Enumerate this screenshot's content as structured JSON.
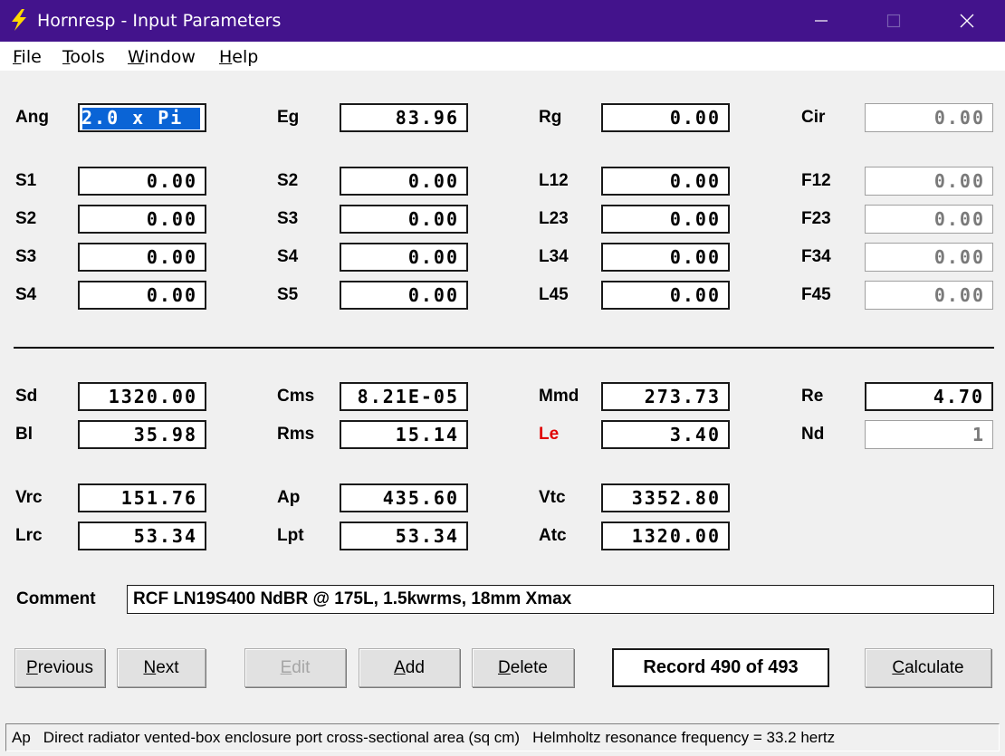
{
  "window": {
    "title": "Hornresp - Input Parameters",
    "title_bar_color": "#43138c",
    "controls": [
      "minimize-icon",
      "maximize-icon",
      "close-icon"
    ]
  },
  "menu": [
    {
      "first": "F",
      "rest": "ile"
    },
    {
      "first": "T",
      "rest": "ools"
    },
    {
      "first": "W",
      "rest": "indow"
    },
    {
      "first": "H",
      "rest": "elp"
    }
  ],
  "rows": {
    "top": {
      "ang": {
        "label": "Ang",
        "value": "2.0 x Pi"
      },
      "eg": {
        "label": "Eg",
        "value": "83.96"
      },
      "rg": {
        "label": "Rg",
        "value": "0.00"
      },
      "cir": {
        "label": "Cir",
        "value": "0.00"
      }
    },
    "horn": [
      [
        {
          "label": "S1",
          "value": "0.00"
        },
        {
          "label": "S2",
          "value": "0.00"
        },
        {
          "label": "L12",
          "value": "0.00"
        },
        {
          "label": "F12",
          "value": "0.00"
        }
      ],
      [
        {
          "label": "S2",
          "value": "0.00"
        },
        {
          "label": "S3",
          "value": "0.00"
        },
        {
          "label": "L23",
          "value": "0.00"
        },
        {
          "label": "F23",
          "value": "0.00"
        }
      ],
      [
        {
          "label": "S3",
          "value": "0.00"
        },
        {
          "label": "S4",
          "value": "0.00"
        },
        {
          "label": "L34",
          "value": "0.00"
        },
        {
          "label": "F34",
          "value": "0.00"
        }
      ],
      [
        {
          "label": "S4",
          "value": "0.00"
        },
        {
          "label": "S5",
          "value": "0.00"
        },
        {
          "label": "L45",
          "value": "0.00"
        },
        {
          "label": "F45",
          "value": "0.00"
        }
      ]
    ],
    "driver": [
      [
        {
          "label": "Sd",
          "value": "1320.00"
        },
        {
          "label": "Cms",
          "value": "8.21E-05"
        },
        {
          "label": "Mmd",
          "value": "273.73"
        },
        {
          "label": "Re",
          "value": "4.70"
        }
      ],
      [
        {
          "label": "Bl",
          "value": "35.98"
        },
        {
          "label": "Rms",
          "value": "15.14"
        },
        {
          "label": "Le",
          "value": "3.40"
        },
        {
          "label": "Nd",
          "value": "1"
        }
      ]
    ],
    "chambers": [
      [
        {
          "label": "Vrc",
          "value": "151.76"
        },
        {
          "label": "Ap",
          "value": "435.60"
        },
        {
          "label": "Vtc",
          "value": "3352.80"
        }
      ],
      [
        {
          "label": "Lrc",
          "value": "53.34"
        },
        {
          "label": "Lpt",
          "value": "53.34"
        },
        {
          "label": "Atc",
          "value": "1320.00"
        }
      ]
    ]
  },
  "comment": {
    "label": "Comment",
    "value": "RCF LN19S400 NdBR @ 175L, 1.5kwrms, 18mm Xmax"
  },
  "buttons": {
    "previous": {
      "first": "P",
      "rest": "revious"
    },
    "next": {
      "first": "N",
      "rest": "ext"
    },
    "edit": {
      "first": "E",
      "rest": "dit"
    },
    "add": {
      "first": "A",
      "rest": "dd"
    },
    "delete": {
      "first": "D",
      "rest": "elete"
    },
    "calculate": {
      "first": "C",
      "rest": "alculate"
    }
  },
  "record": "Record 490 of 493",
  "status": {
    "param": "Ap",
    "description": "Direct radiator vented-box enclosure port cross-sectional area  (sq cm)",
    "extra": "Helmholtz resonance frequency = 33.2 hertz"
  },
  "colors": {
    "selection": "#0a64d6",
    "le_label": "#e00000",
    "app_icon": "#ffd800"
  }
}
